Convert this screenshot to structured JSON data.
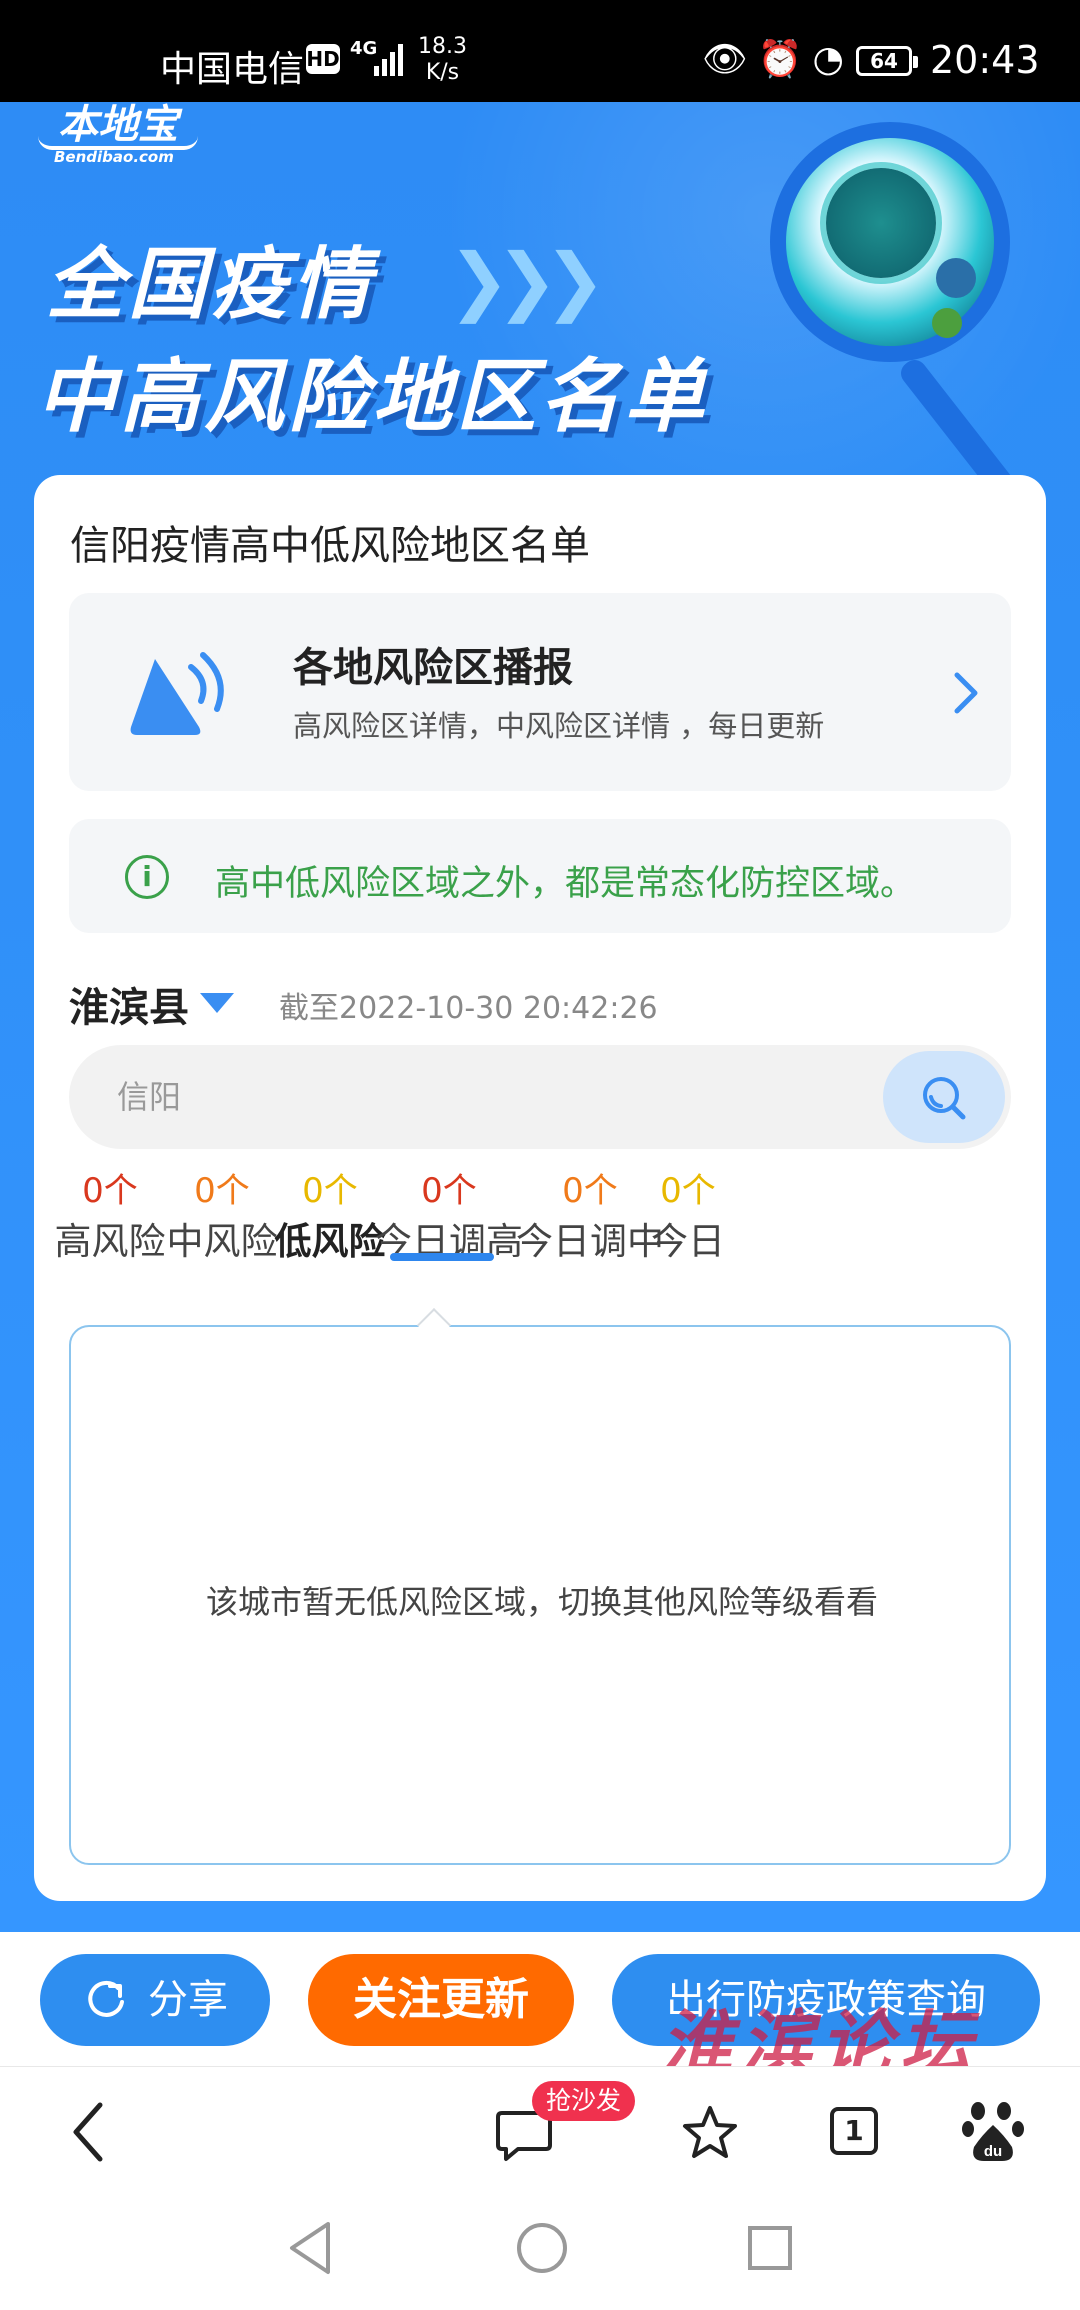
{
  "status_bar": {
    "carrier": "中国电信",
    "hd": "HD",
    "network": "4G",
    "speed_value": "18.3",
    "speed_unit": "K/s",
    "battery": "64",
    "time": "20:43"
  },
  "banner": {
    "logo_cn": "本地宝",
    "logo_en": "Bendibao.com",
    "headline1": "全国疫情",
    "headline2": "中高风险地区名单"
  },
  "card": {
    "title": "信阳疫情高中低风险地区名单",
    "broadcast": {
      "title": "各地风险区播报",
      "subtitle": "高风险区详情，中风险区详情 ，每日更新"
    },
    "notice": "高中低风险区域之外，都是常态化防控区域。",
    "region": "淮滨县",
    "timestamp": "截至2022-10-30 20:42:26",
    "search_placeholder": "信阳",
    "tabs": [
      {
        "count": "0个",
        "label": "高风险",
        "color": "#d9381e"
      },
      {
        "count": "0个",
        "label": "中风险",
        "color": "#f07a1a"
      },
      {
        "count": "0个",
        "label": "低风险",
        "color": "#e8b800"
      },
      {
        "count": "0个",
        "label": "今日调高",
        "color": "#d9381e"
      },
      {
        "count": "0个",
        "label": "今日调中",
        "color": "#f07a1a"
      },
      {
        "count": "0个",
        "label": "今日",
        "color": "#e8b800"
      }
    ],
    "active_tab": "低风险",
    "empty_message": "该城市暂无低风险区域，切换其他风险等级看看"
  },
  "actions": {
    "share": "分享",
    "follow": "关注更新",
    "policy": "出行防疫政策查询"
  },
  "watermark": "淮滨论坛",
  "browser": {
    "badge": "抢沙发",
    "tab_count": "1",
    "icons": [
      "back-icon",
      "comment-icon",
      "star-icon",
      "tabs-icon",
      "baidu-icon"
    ]
  },
  "colors": {
    "primary": "#2e8ef0",
    "accent": "#ff6a00",
    "notice_green": "#3aa14a"
  }
}
